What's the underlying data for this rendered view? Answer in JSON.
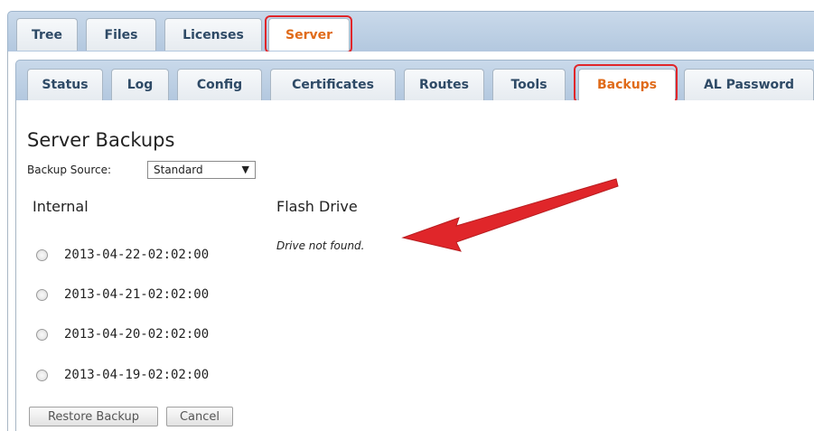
{
  "top_tabs": [
    {
      "label": "Tree"
    },
    {
      "label": "Files"
    },
    {
      "label": "Licenses"
    },
    {
      "label": "Server"
    }
  ],
  "server_tabs": [
    {
      "label": "Status"
    },
    {
      "label": "Log"
    },
    {
      "label": "Config"
    },
    {
      "label": "Certificates"
    },
    {
      "label": "Routes"
    },
    {
      "label": "Tools"
    },
    {
      "label": "Backups"
    },
    {
      "label": "AL Password"
    }
  ],
  "page": {
    "title": "Server Backups",
    "source_label": "Backup Source:",
    "source_value": "Standard",
    "internal_heading": "Internal",
    "flash_heading": "Flash Drive",
    "flash_message": "Drive not found.",
    "backups": [
      "2013-04-22-02:02:00",
      "2013-04-21-02:02:00",
      "2013-04-20-02:02:00",
      "2013-04-19-02:02:00"
    ],
    "restore_label": "Restore Backup",
    "cancel_label": "Cancel"
  },
  "colors": {
    "active_tab_text": "#e06b1a",
    "highlight": "#e0262a",
    "arrow": "#e0262a"
  }
}
